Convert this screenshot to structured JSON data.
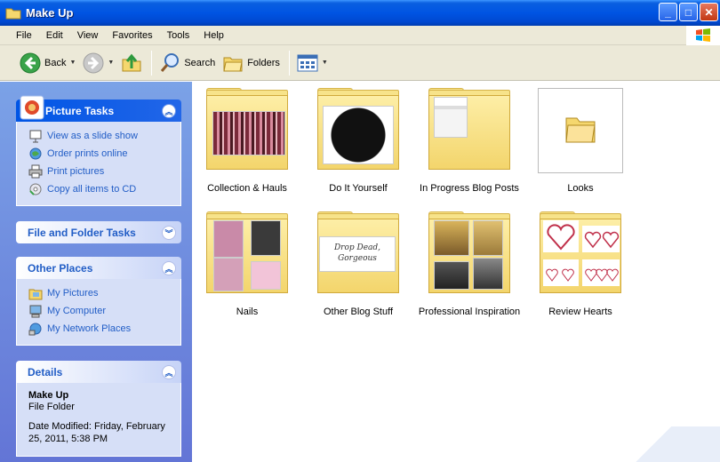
{
  "window": {
    "title": "Make Up"
  },
  "menu": [
    "File",
    "Edit",
    "View",
    "Favorites",
    "Tools",
    "Help"
  ],
  "toolbar": {
    "back": "Back",
    "search": "Search",
    "folders": "Folders"
  },
  "left": {
    "picture_tasks": {
      "title": "Picture Tasks",
      "items": [
        "View as a slide show",
        "Order prints online",
        "Print pictures",
        "Copy all items to CD"
      ]
    },
    "file_folder_tasks": {
      "title": "File and Folder Tasks"
    },
    "other_places": {
      "title": "Other Places",
      "items": [
        "My Pictures",
        "My Computer",
        "My Network Places"
      ]
    },
    "details": {
      "title": "Details",
      "name": "Make Up",
      "type": "File Folder",
      "modified": "Date Modified: Friday, February 25, 2011, 5:38 PM"
    }
  },
  "folders": [
    "Collection & Hauls",
    "Do It Yourself",
    "In Progress Blog Posts",
    "Looks",
    "Nails",
    "Other Blog Stuff",
    "Professional Inspiration",
    "Review Hearts"
  ],
  "thumb_text": {
    "other_blog_stuff": "Drop Dead, Gorgeous"
  },
  "colors": {
    "title_blue": "#0054e3",
    "task_blue": "#215dc6",
    "folder_yellow": "#f3d56c"
  }
}
